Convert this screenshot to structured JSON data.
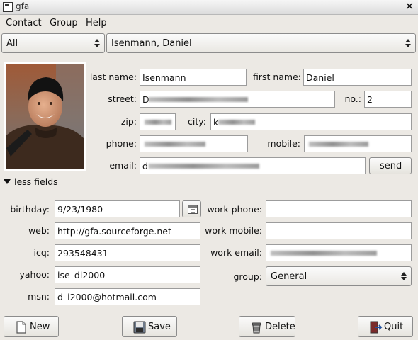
{
  "window": {
    "title": "gfa"
  },
  "menu": {
    "items": [
      "Contact",
      "Group",
      "Help"
    ]
  },
  "filter": {
    "selected": "All"
  },
  "contact_select": {
    "selected": "Isenmann, Daniel"
  },
  "form": {
    "last_name_label": "last name:",
    "last_name": "Isenmann",
    "first_name_label": "first name:",
    "first_name": "Daniel",
    "street_label": "street:",
    "street_prefix": "D",
    "no_label": "no.:",
    "no": "2",
    "zip_label": "zip:",
    "city_label": "city:",
    "city_prefix": "k",
    "phone_label": "phone:",
    "mobile_label": "mobile:",
    "email_label": "email:",
    "email_prefix": "d",
    "send_label": "send"
  },
  "expander": {
    "label": "less fields"
  },
  "extra": {
    "birthday_label": "birthday:",
    "birthday": "9/23/1980",
    "web_label": "web:",
    "web": "http://gfa.sourceforge.net",
    "icq_label": "icq:",
    "icq": "293548431",
    "yahoo_label": "yahoo:",
    "yahoo": "ise_di2000",
    "msn_label": "msn:",
    "msn": "d_i2000@hotmail.com",
    "work_phone_label": "work phone:",
    "work_mobile_label": "work mobile:",
    "work_email_label": "work email:",
    "group_label": "group:",
    "group": "General"
  },
  "buttons": {
    "new_label": "New",
    "save_label": "Save",
    "delete_label": "Delete",
    "quit_label": "Quit"
  }
}
